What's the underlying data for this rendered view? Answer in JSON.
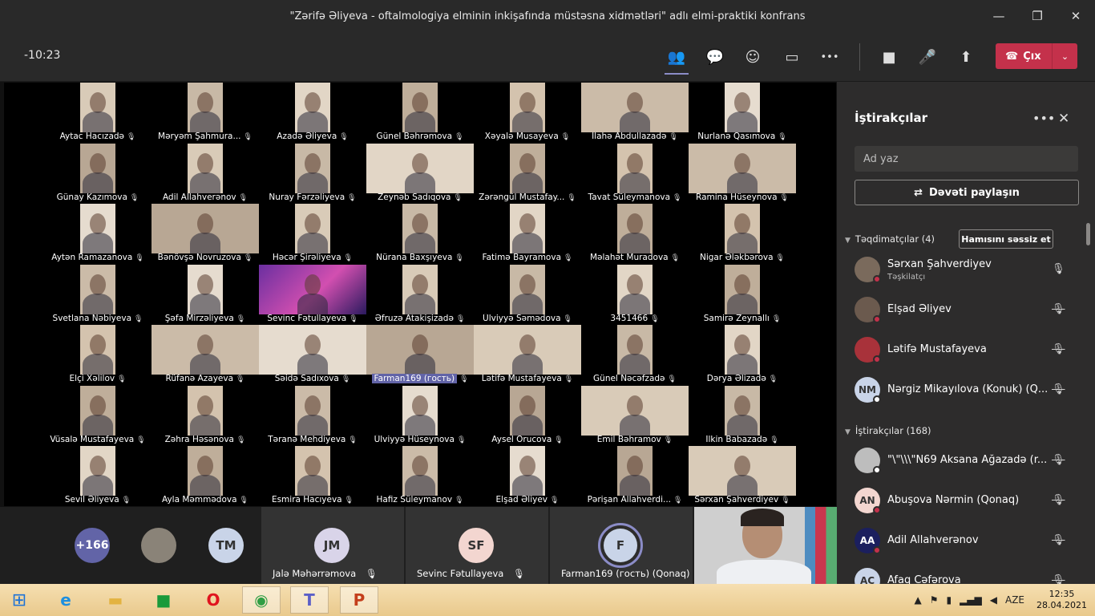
{
  "window": {
    "title": "\"Zərifə Əliyeva - oftalmologiya elminin inkişafında müstəsna xidmətləri\" adlı elmi-praktiki konfrans",
    "controls": {
      "minimize": "—",
      "maximize": "❐",
      "close": "✕"
    }
  },
  "toolbar": {
    "timer": "-10:23",
    "leave_label": "Çıx",
    "icons": {
      "participants": "👥",
      "chat": "💬",
      "reactions": "☺",
      "rooms": "▭",
      "more": "•••",
      "camera": "■",
      "mic": "🎤",
      "share": "⬆",
      "phone": "☎",
      "chevron": "⌄"
    }
  },
  "gallery": {
    "mic_glyph": "🎙",
    "rows": [
      [
        "Aytac Hacızadə",
        "Məryəm Şahmura...",
        "Azadə Əliyeva",
        "Günel Bəhrəmova",
        "Xəyalə Musayeva",
        "İlahə Abdullazadə",
        "Nurlanə Qasımova"
      ],
      [
        "Günay Kazımova",
        "Adil Allahverənov",
        "Nuray Fərzəliyeva",
        "Zeynəb Sadıqova",
        "Zərəngül Mustafay...",
        "Tavat Süleymanova",
        "Ramina Hüseynova"
      ],
      [
        "Aytən Ramazanova",
        "Bənövşə Novruzova",
        "Həcər Şirəliyeva",
        "Nürana Baxşıyeva",
        "Fatimə Bayramova",
        "Məlahət Muradova",
        "Nigar Ələkbərova"
      ],
      [
        "Svetlana Nəbiyeva",
        "Şəfa Mirzəliyeva",
        "Sevinc Fətullayeva",
        "Əfruzə Atakişizadə",
        "Ülviyyə Səmədova",
        "3451466",
        "Samirə Zeynallı"
      ],
      [
        "Elçi Xəlilov",
        "Rüfanə Azayeva",
        "Səidə Sadıxova",
        "Farman169 (гость)",
        "Lətifə Mustafayeva",
        "Günel Nəcəfzadə",
        "Dərya Əlizadə"
      ],
      [
        "Vüsalə Mustafayeva",
        "Zəhra Həsənova",
        "Təranə Mehdiyeva",
        "Ülviyyə Hüseynova",
        "Aysel Orucova",
        "Emil Bəhramov",
        "İlkin Babazadə"
      ],
      [
        "Sevil Əliyeva",
        "Ayla Məmmədova",
        "Esmira Hacıyeva",
        "Hafiz Süleymanov",
        "Elşad Əliyev",
        "Pərişan Allahverdi...",
        "Sərxan Şahverdiyev"
      ]
    ]
  },
  "strip": {
    "overflow_count": "+166",
    "avatars": [
      {
        "initials": "TM"
      }
    ],
    "tiles": [
      {
        "initials": "JM",
        "name": "Jalə Məhərrəmova",
        "mic": "🎙"
      },
      {
        "initials": "SF",
        "name": "Sevinc Fətullayeva",
        "mic": "🎙"
      },
      {
        "initials": "F",
        "name": "Farman169 (гость) (Qonaq)"
      }
    ]
  },
  "panel": {
    "title": "İştirakçılar",
    "more": "•••",
    "close": "✕",
    "search_placeholder": "Ad yaz",
    "invite_label": "Dəvəti paylaşın",
    "invite_icon": "⇄",
    "presenters_header": "Təqdimatçılar (4)",
    "mute_all_label": "Hamısını səssiz et",
    "attendees_header": "İştirakçılar (168)",
    "caret": "▼",
    "presenters": [
      {
        "initials": "",
        "name": "Sərxan Şahverdiyev",
        "role": "Təşkilatçı",
        "mic": "🎙"
      },
      {
        "initials": "",
        "name": "Elşad Əliyev",
        "mic": "🎙"
      },
      {
        "initials": "",
        "name": "Lətifə Mustafayeva",
        "mic": "🎙"
      },
      {
        "initials": "NM",
        "name": "Nərgiz Mikayılova (Konuk) (Q...",
        "mic": "🎙"
      }
    ],
    "attendees": [
      {
        "initials": "",
        "name": "\"\\\"\\\\\\\"N69 Aksana Ağazadə (r...",
        "mic": "🎙"
      },
      {
        "initials": "AN",
        "name": "Abuşova Nərmin (Qonaq)",
        "mic": "🎙"
      },
      {
        "initials": "AA",
        "name": "Adil Allahverənov",
        "mic": "🎙"
      },
      {
        "initials": "AC",
        "name": "Afaq Cəfərova",
        "mic": "🎙"
      }
    ]
  },
  "taskbar": {
    "lang": "AZE",
    "time": "12:35",
    "date": "28.04.2021",
    "tray_up": "▲"
  },
  "colors": {
    "accent": "#6264a7",
    "leave": "#c4314b",
    "panel_bg": "#2d2c2c",
    "toolbar_bg": "#292929"
  }
}
